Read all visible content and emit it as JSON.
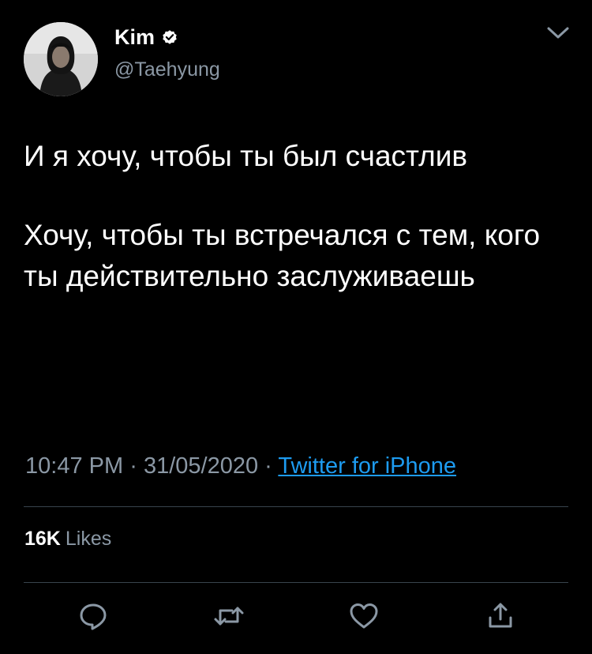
{
  "author": {
    "display_name": "Kim",
    "handle": "@Taehyung",
    "verified": true,
    "avatar_icon": "profile-photo"
  },
  "menu": {
    "icon": "chevron-down-icon"
  },
  "tweet": {
    "paragraphs": [
      "И я хочу, чтобы ты был счастлив",
      "Хочу, чтобы ты встречался с тем, кого ты действительно заслуживаешь"
    ]
  },
  "meta": {
    "time": "10:47 PM",
    "separator": "·",
    "date": "31/05/2020",
    "source": "Twitter for iPhone"
  },
  "stats": {
    "likes_count": "16K",
    "likes_label": "Likes"
  },
  "actions": [
    {
      "name": "reply",
      "icon": "reply-icon"
    },
    {
      "name": "retweet",
      "icon": "retweet-icon"
    },
    {
      "name": "like",
      "icon": "heart-icon"
    },
    {
      "name": "share",
      "icon": "share-icon"
    }
  ],
  "colors": {
    "background": "#000000",
    "text_primary": "#ffffff",
    "text_secondary": "#8b98a5",
    "link": "#1d9bf0",
    "divider": "#38444d"
  }
}
